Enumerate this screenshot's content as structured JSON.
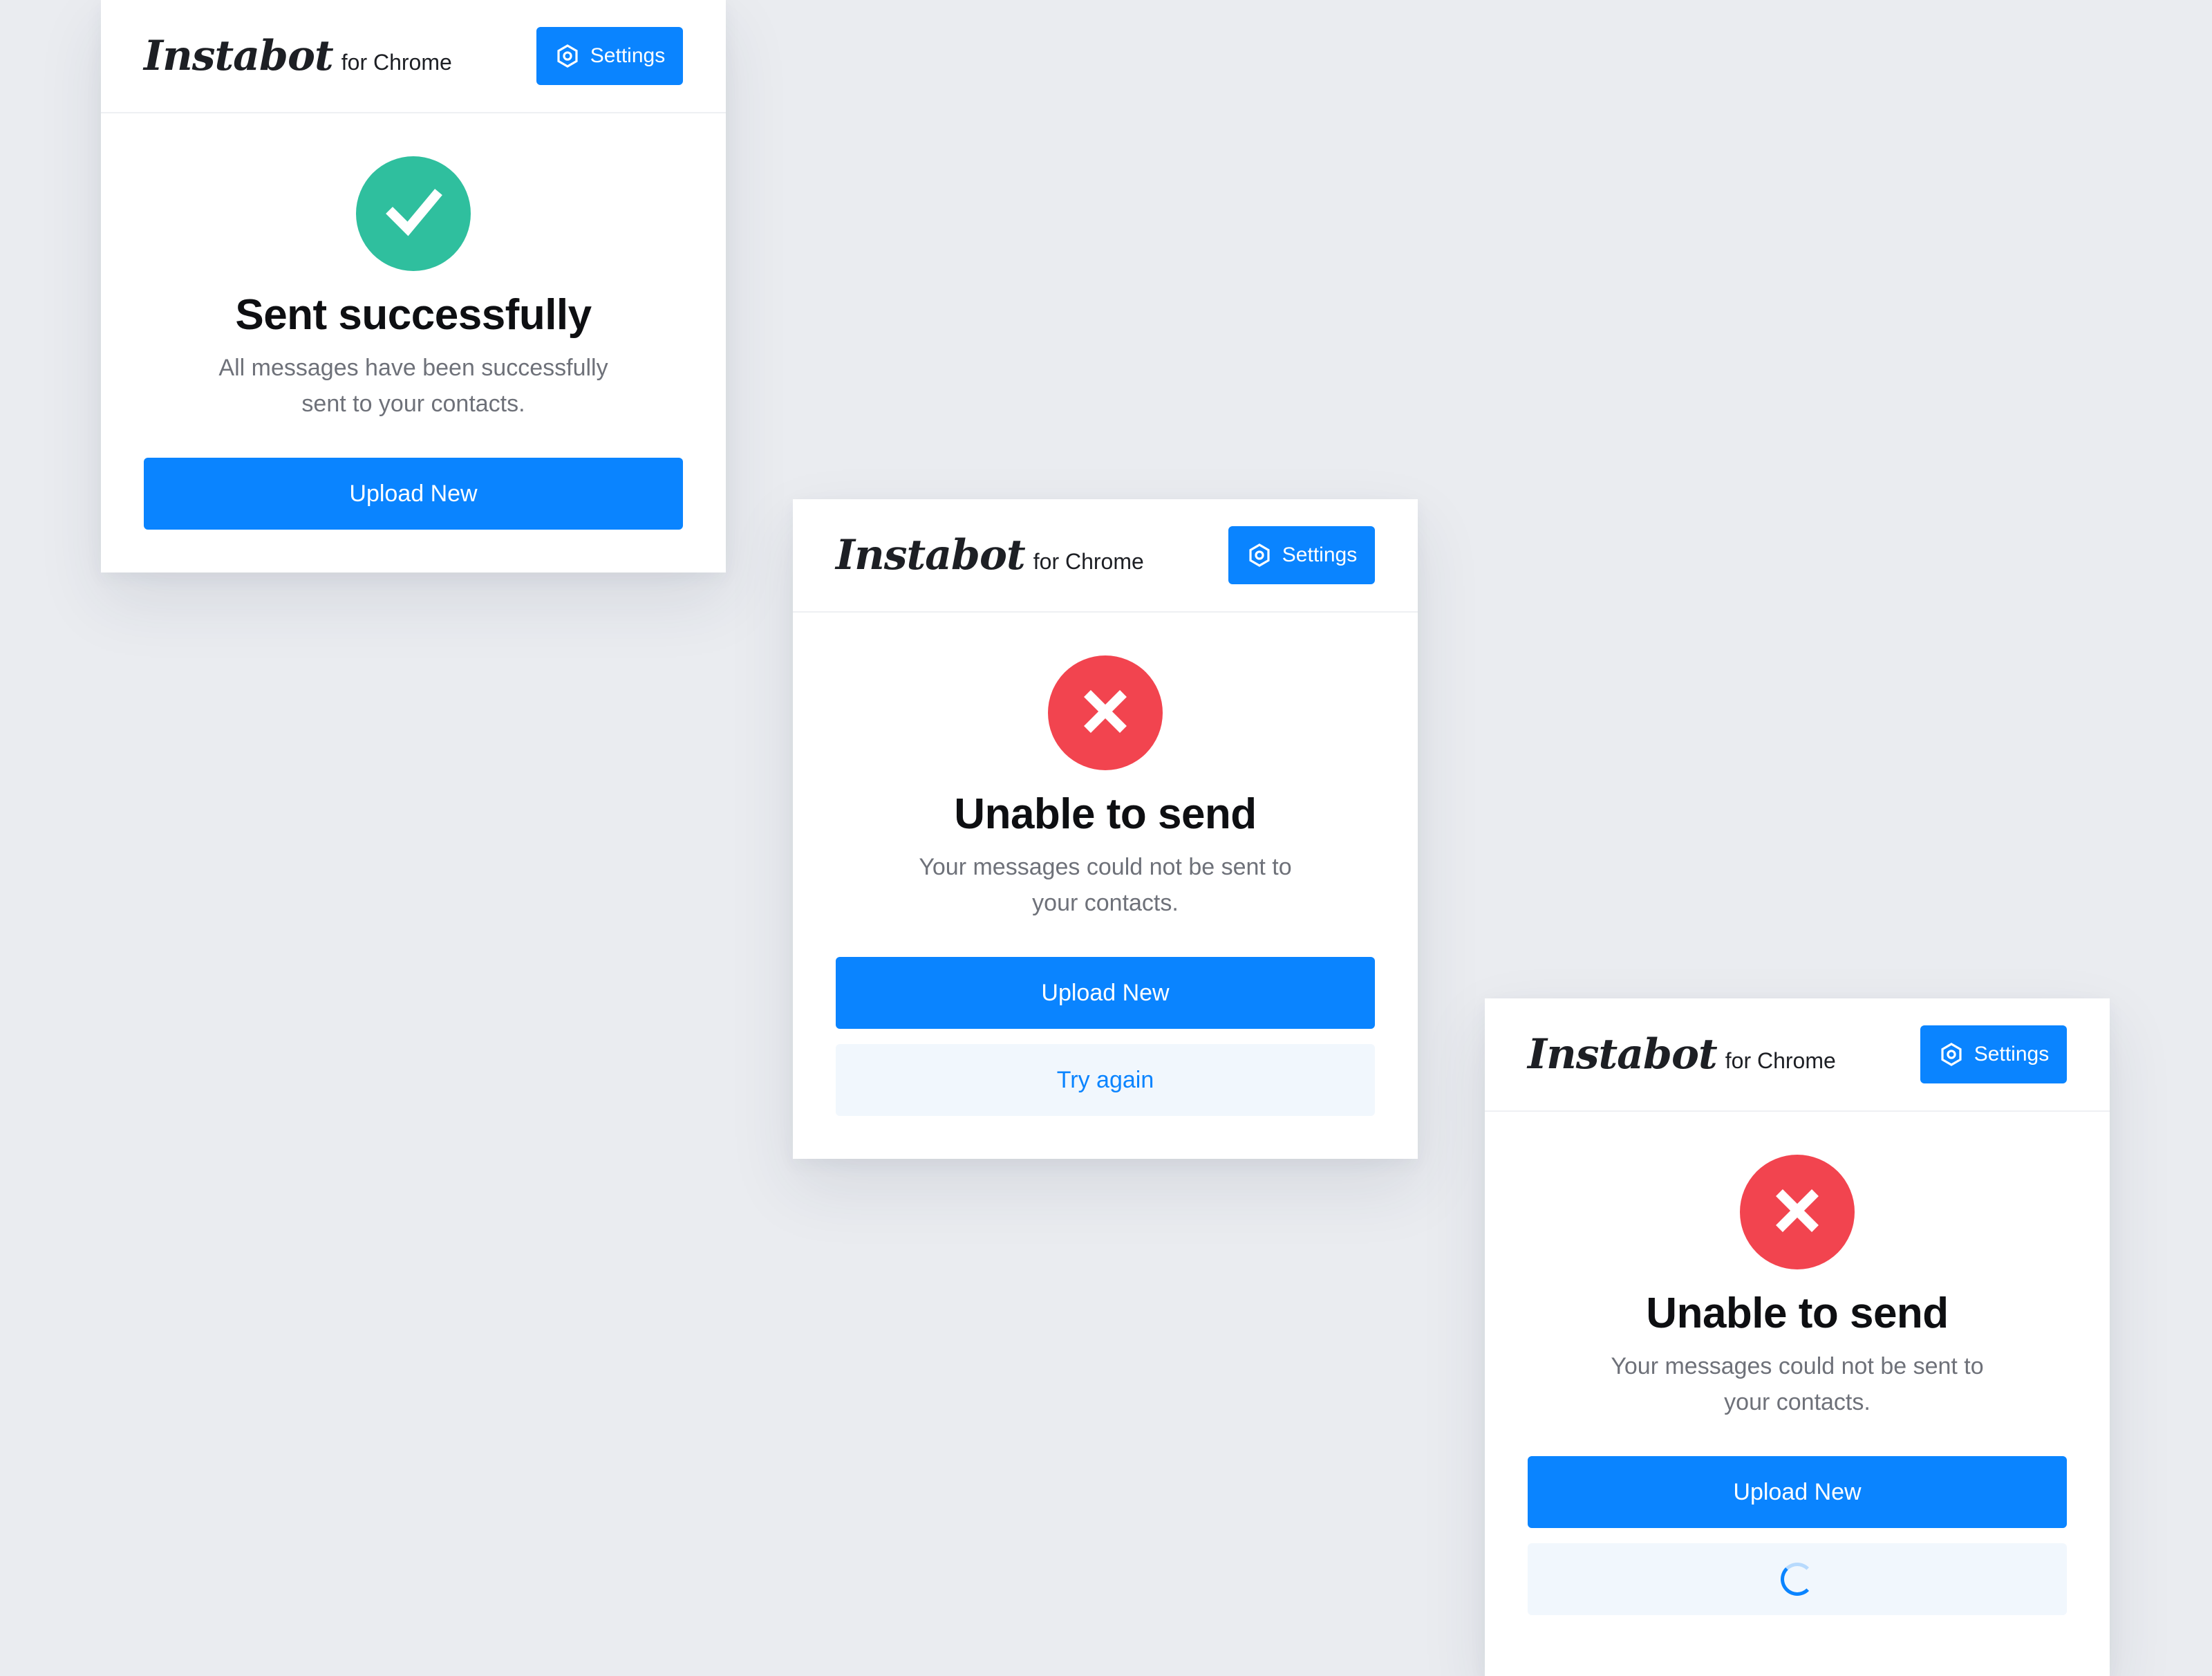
{
  "brand": {
    "logo": "Instabot",
    "subtitle": "for Chrome"
  },
  "settings_label": "Settings",
  "cards": [
    {
      "status": "success",
      "title": "Sent successfully",
      "description": "All messages have been successfully sent to your contacts.",
      "primary_label": "Upload New"
    },
    {
      "status": "error",
      "title": "Unable to send",
      "description": "Your messages could not be sent to your contacts.",
      "primary_label": "Upload New",
      "secondary_label": "Try again"
    },
    {
      "status": "error",
      "title": "Unable to send",
      "description": "Your messages could not be sent to your contacts.",
      "primary_label": "Upload New",
      "secondary_state": "loading"
    }
  ],
  "colors": {
    "accent": "#0a84ff",
    "success": "#2fbf9e",
    "error": "#f2444f",
    "background": "#eaecf0"
  },
  "icons": {
    "settings": "settings-gear-icon",
    "success": "checkmark-icon",
    "error": "x-mark-icon",
    "loading": "loading-spinner-icon"
  }
}
